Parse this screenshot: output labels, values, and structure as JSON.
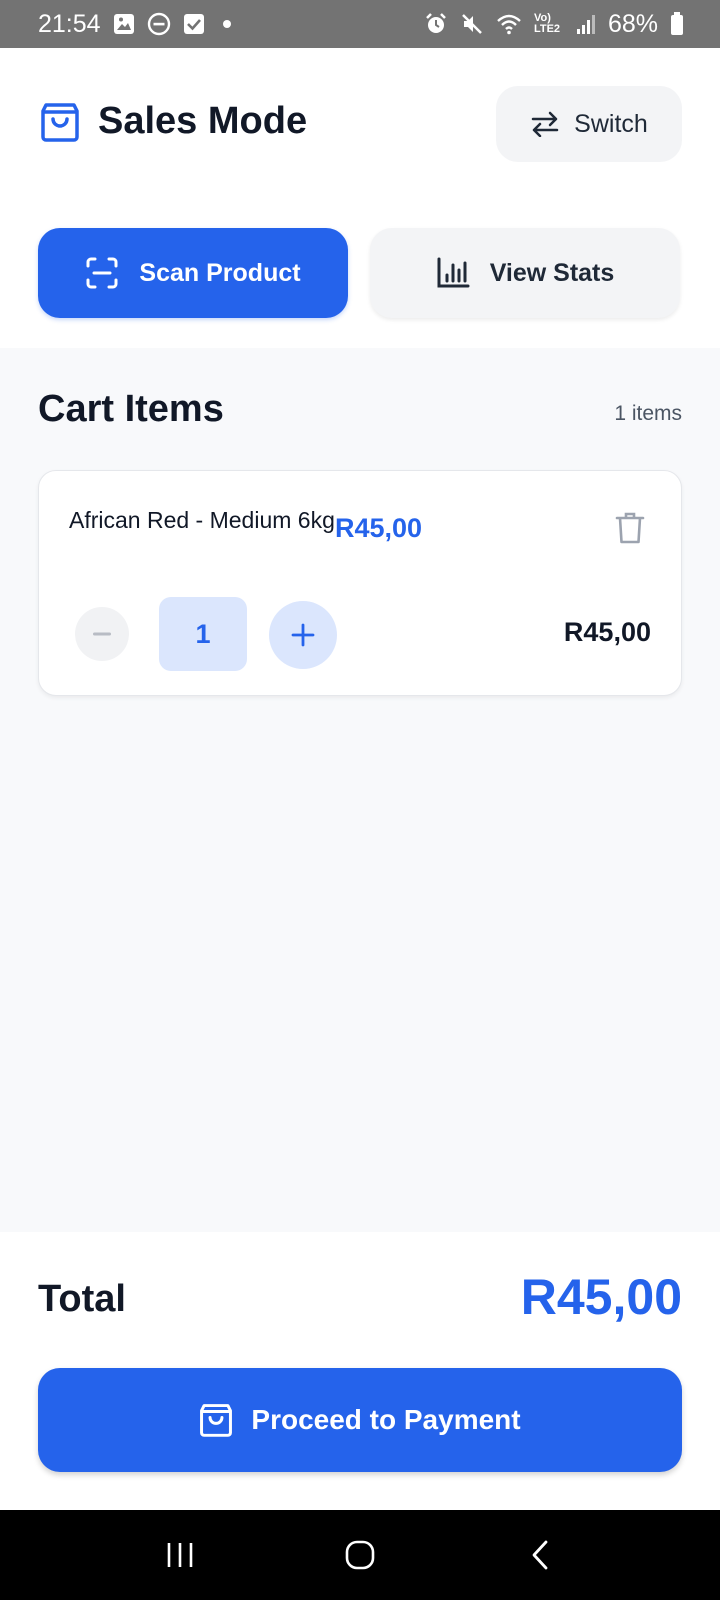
{
  "status_bar": {
    "time": "21:54",
    "network": "Vo) LTE2",
    "battery": "68%",
    "icons_left": [
      "image-icon",
      "dnd-icon",
      "check-icon",
      "dot-icon"
    ],
    "icons_right": [
      "alarm-icon",
      "mute-icon",
      "wifi-icon",
      "signal-icon",
      "battery-icon"
    ]
  },
  "header": {
    "title": "Sales Mode",
    "switch_label": "Switch"
  },
  "actions": {
    "scan_label": "Scan Product",
    "stats_label": "View Stats"
  },
  "cart": {
    "heading": "Cart Items",
    "count": "1 items",
    "items": [
      {
        "name": "African Red - Medium 6kg",
        "unit_price": "R45,00",
        "quantity": "1",
        "line_total": "R45,00"
      }
    ]
  },
  "footer": {
    "total_label": "Total",
    "total_value": "R45,00",
    "pay_label": "Proceed to Payment"
  },
  "colors": {
    "accent": "#2563eb",
    "accent_light": "#dbe6fd",
    "status_bar": "#737373"
  }
}
